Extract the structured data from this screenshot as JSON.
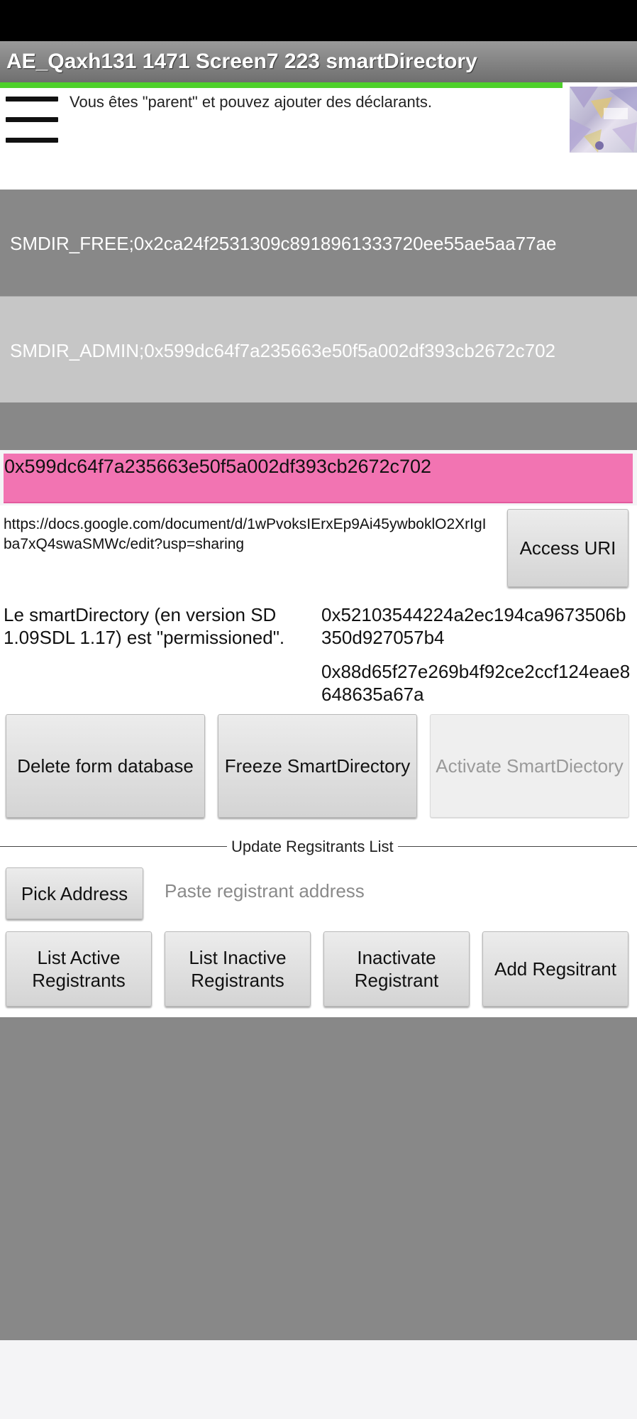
{
  "app": {
    "title": "AE_Qaxh131 1471 Screen7 223 smartDirectory",
    "parent_message": "Vous êtes \"parent\" et pouvez ajouter des déclarants."
  },
  "bands": {
    "free": "SMDIR_FREE;0x2ca24f2531309c8918961333720ee55ae5aa77ae",
    "admin": "SMDIR_ADMIN;0x599dc64f7a235663e50f5a002df393cb2672c702"
  },
  "selected_address": "0x599dc64f7a235663e50f5a002df393cb2672c702",
  "uri": {
    "text": "https://docs.google.com/document/d/1wPvoksIErxEp9Ai45ywboklO2XrIgIba7xQ4swaSMWc/edit?usp=sharing",
    "button": "Access URI"
  },
  "info": {
    "permission_text": "Le smartDirectory (en version SD 1.09SDL 1.17) est \"permissioned\".",
    "address1": "0x52103544224a2ec194ca9673506b350d927057b4",
    "address2": "0x88d65f27e269b4f92ce2ccf124eae8648635a67a"
  },
  "actions": {
    "delete": "Delete form database",
    "freeze": "Freeze SmartDirectory",
    "activate": "Activate SmartDiectory"
  },
  "registrants": {
    "section_label": "Update Regsitrants List",
    "pick_address": "Pick Address",
    "paste_placeholder": "Paste registrant address",
    "list_active": "List Active Registrants",
    "list_inactive": "List Inactive Registrants",
    "inactivate": "Inactivate Registrant",
    "add": "Add Regsitrant"
  }
}
